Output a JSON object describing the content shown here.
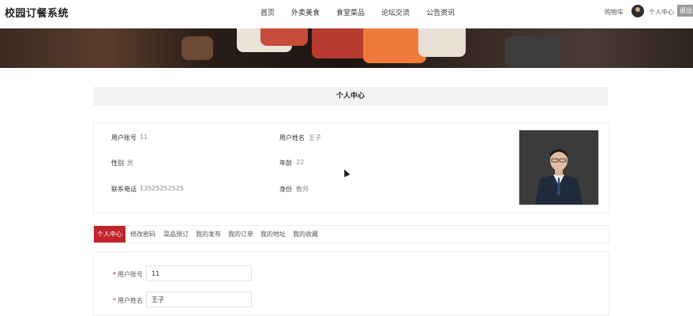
{
  "app_title": "校园订餐系统",
  "nav": {
    "items": [
      "首页",
      "外卖美食",
      "食堂菜品",
      "论坛交流",
      "公告资讯"
    ]
  },
  "header_right": {
    "cart_label": "购物车",
    "center_label": "个人中心",
    "logout_label": "退出"
  },
  "section": {
    "title": "个人中心"
  },
  "profile": {
    "account_label": "用户账号",
    "account_value": "11",
    "name_label": "用户姓名",
    "name_value": "王子",
    "gender_label": "性别",
    "gender_value": "男",
    "age_label": "年龄",
    "age_value": "22",
    "phone_label": "联系电话",
    "phone_value": "13525252525",
    "identity_label": "身份",
    "identity_value": "教师"
  },
  "tabs": [
    "个人中心",
    "修改密码",
    "菜品预订",
    "我的发布",
    "我的订单",
    "我的地址",
    "我的收藏"
  ],
  "form": {
    "account_label": "用户账号",
    "account_value": "11",
    "name_label": "用户姓名",
    "name_value": "王子"
  }
}
